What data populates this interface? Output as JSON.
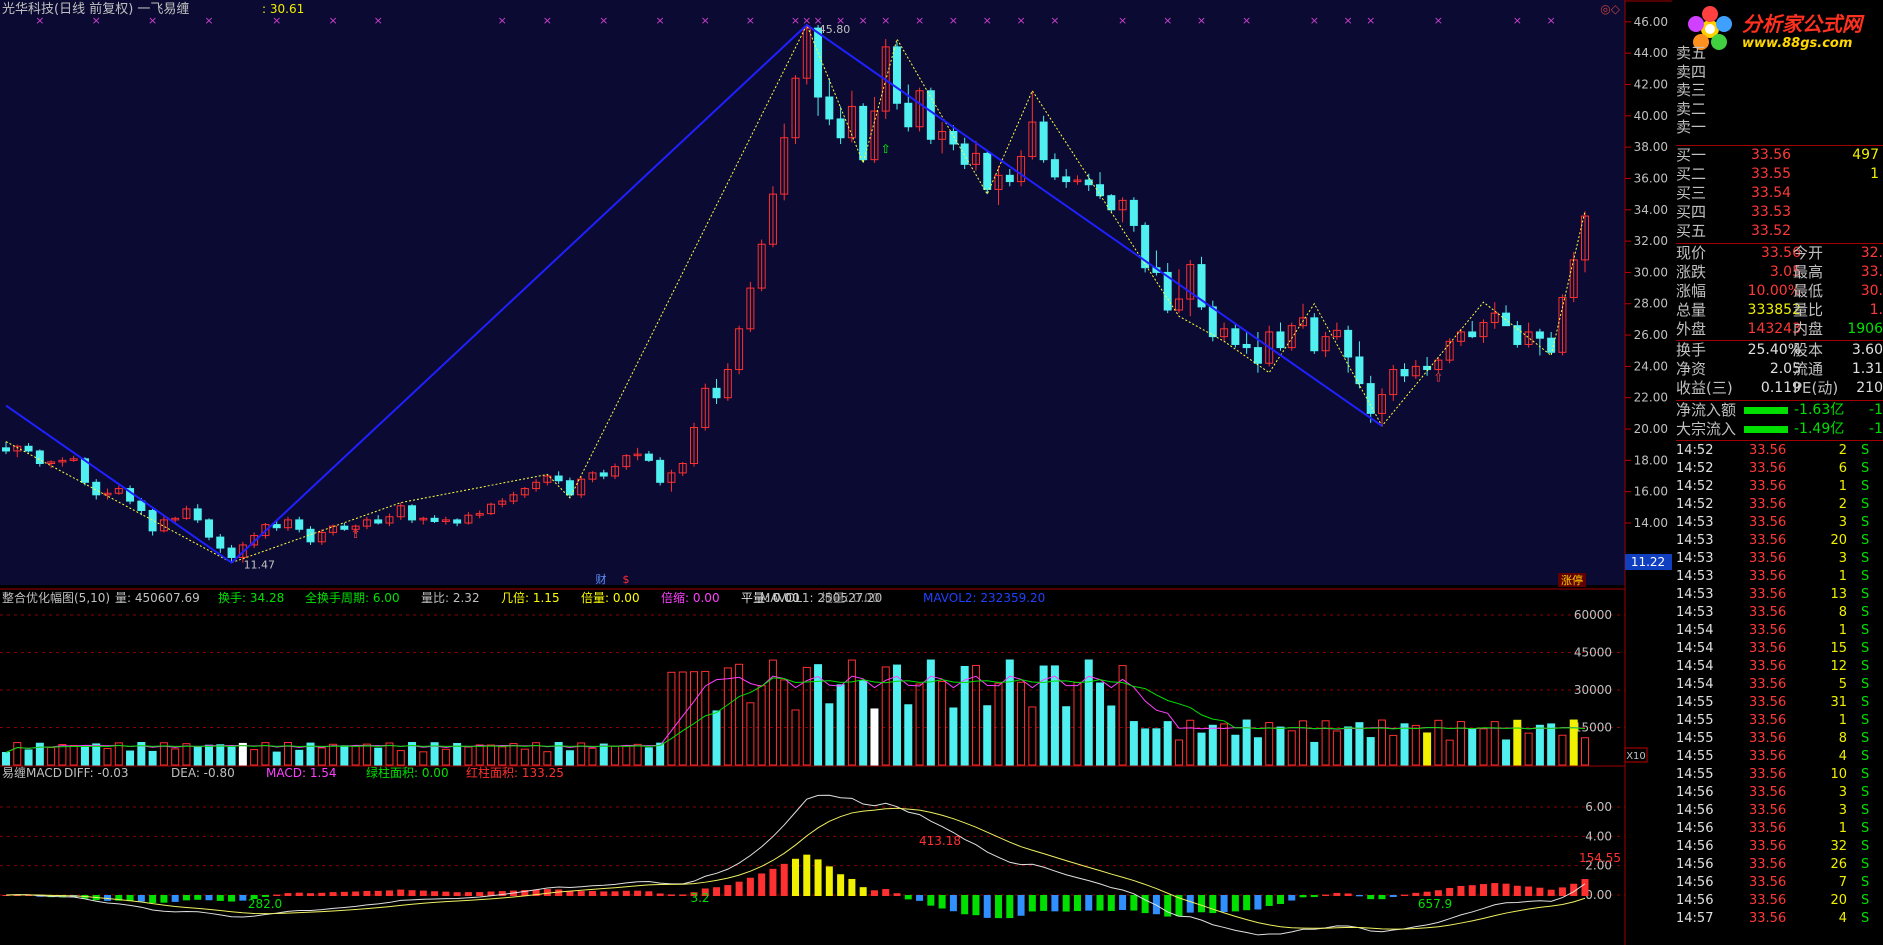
{
  "colors": {
    "up": "#ff3030",
    "down": "#50f0f0",
    "blue_line": "#2020ff",
    "zig": "#ffff40",
    "panel_bg": "#0a0a32",
    "grid": "#8a0000",
    "text": "#c0c0c0"
  },
  "main_chart": {
    "title": "光华科技(日线 前复权) 一飞易缠",
    "value": ": 30.61",
    "y_ticks": [
      "46.00",
      "44.00",
      "42.00",
      "40.00",
      "38.00",
      "36.00",
      "34.00",
      "32.00",
      "30.00",
      "28.00",
      "26.00",
      "24.00",
      "22.00",
      "20.00",
      "18.00",
      "16.00",
      "14.00"
    ],
    "peak_label": "45.80",
    "low_label": "11.47",
    "last_price_tag": "11.22",
    "marker_cai": "财",
    "marker_dollar": "$",
    "marker_zt": "涨停",
    "marker_x": "×",
    "corner_icons": "◎◇"
  },
  "chart_data": {
    "type": "candlestick",
    "x_label": "trading day index",
    "ohlc": [
      [
        18.8,
        19.2,
        18.4,
        18.6
      ],
      [
        18.6,
        19.0,
        18.2,
        18.9
      ],
      [
        18.9,
        19.1,
        18.5,
        18.6
      ],
      [
        18.6,
        18.7,
        17.6,
        17.8
      ],
      [
        17.8,
        18.0,
        17.5,
        17.9
      ],
      [
        17.9,
        18.2,
        17.6,
        18.0
      ],
      [
        18.0,
        18.3,
        17.9,
        18.1
      ],
      [
        18.1,
        18.2,
        16.4,
        16.6
      ],
      [
        16.6,
        16.8,
        15.5,
        15.8
      ],
      [
        15.8,
        16.2,
        15.5,
        15.9
      ],
      [
        15.9,
        16.4,
        15.8,
        16.2
      ],
      [
        16.2,
        16.4,
        15.2,
        15.4
      ],
      [
        15.4,
        15.6,
        14.5,
        14.8
      ],
      [
        14.8,
        14.9,
        13.2,
        13.5
      ],
      [
        13.5,
        14.5,
        13.4,
        14.2
      ],
      [
        14.2,
        14.4,
        14.0,
        14.3
      ],
      [
        14.3,
        15.1,
        14.2,
        14.9
      ],
      [
        14.9,
        15.2,
        14.0,
        14.2
      ],
      [
        14.2,
        14.3,
        12.9,
        13.1
      ],
      [
        13.1,
        13.3,
        12.1,
        12.4
      ],
      [
        12.4,
        12.6,
        11.5,
        11.8
      ],
      [
        11.8,
        12.8,
        11.47,
        12.6
      ],
      [
        12.6,
        13.4,
        12.4,
        13.2
      ],
      [
        13.2,
        14.0,
        13.0,
        13.9
      ],
      [
        13.9,
        14.2,
        13.5,
        13.7
      ],
      [
        13.7,
        14.4,
        13.5,
        14.2
      ],
      [
        14.2,
        14.4,
        13.4,
        13.6
      ],
      [
        13.6,
        13.8,
        12.6,
        12.8
      ],
      [
        12.8,
        13.6,
        12.6,
        13.4
      ],
      [
        13.4,
        13.9,
        13.2,
        13.8
      ],
      [
        13.8,
        14.0,
        13.5,
        13.6
      ],
      [
        13.6,
        13.9,
        13.3,
        13.8
      ],
      [
        13.8,
        14.4,
        13.6,
        14.2
      ],
      [
        14.2,
        14.5,
        13.9,
        14.0
      ],
      [
        14.0,
        14.6,
        13.8,
        14.4
      ],
      [
        14.4,
        15.3,
        14.2,
        15.1
      ],
      [
        15.1,
        15.2,
        14.0,
        14.2
      ],
      [
        14.2,
        14.4,
        13.9,
        14.3
      ],
      [
        14.3,
        14.5,
        14.0,
        14.1
      ],
      [
        14.1,
        14.4,
        13.9,
        14.2
      ],
      [
        14.2,
        14.3,
        13.8,
        14.0
      ],
      [
        14.0,
        14.7,
        13.9,
        14.5
      ],
      [
        14.5,
        14.8,
        14.3,
        14.6
      ],
      [
        14.6,
        15.3,
        14.5,
        15.2
      ],
      [
        15.2,
        15.6,
        15.0,
        15.4
      ],
      [
        15.4,
        16.0,
        15.2,
        15.8
      ],
      [
        15.8,
        16.3,
        15.6,
        16.2
      ],
      [
        16.2,
        16.8,
        16.0,
        16.6
      ],
      [
        16.6,
        17.1,
        16.4,
        17.0
      ],
      [
        17.0,
        17.3,
        16.5,
        16.7
      ],
      [
        16.7,
        16.9,
        15.6,
        15.8
      ],
      [
        15.8,
        17.0,
        15.6,
        16.8
      ],
      [
        16.8,
        17.3,
        16.6,
        17.2
      ],
      [
        17.2,
        17.4,
        16.8,
        17.0
      ],
      [
        17.0,
        17.8,
        16.8,
        17.6
      ],
      [
        17.6,
        18.4,
        17.4,
        18.3
      ],
      [
        18.3,
        18.8,
        18.0,
        18.4
      ],
      [
        18.4,
        18.6,
        17.9,
        18.0
      ],
      [
        18.0,
        18.2,
        16.4,
        16.6
      ],
      [
        16.6,
        17.4,
        16.0,
        17.2
      ],
      [
        17.2,
        17.9,
        17.0,
        17.8
      ],
      [
        17.8,
        20.4,
        17.6,
        20.1
      ],
      [
        20.1,
        22.9,
        19.9,
        22.6
      ],
      [
        22.6,
        23.2,
        21.6,
        22.0
      ],
      [
        22.0,
        24.2,
        21.8,
        23.8
      ],
      [
        23.8,
        26.6,
        23.5,
        26.4
      ],
      [
        26.4,
        29.4,
        26.2,
        29.0
      ],
      [
        29.0,
        32.1,
        28.8,
        31.8
      ],
      [
        31.8,
        35.5,
        31.6,
        35.0
      ],
      [
        35.0,
        39.5,
        34.6,
        38.6
      ],
      [
        38.6,
        42.6,
        38.2,
        42.4
      ],
      [
        42.4,
        45.8,
        42.0,
        45.6
      ],
      [
        45.6,
        45.8,
        40.0,
        41.2
      ],
      [
        41.2,
        42.4,
        39.4,
        39.8
      ],
      [
        39.8,
        40.6,
        38.2,
        38.6
      ],
      [
        38.6,
        41.6,
        38.3,
        40.6
      ],
      [
        40.6,
        40.8,
        37.0,
        37.2
      ],
      [
        37.2,
        41.2,
        37.0,
        40.3
      ],
      [
        40.3,
        44.9,
        39.8,
        44.4
      ],
      [
        44.4,
        44.7,
        40.4,
        40.8
      ],
      [
        40.8,
        42.0,
        39.0,
        39.3
      ],
      [
        39.3,
        41.8,
        39.0,
        41.6
      ],
      [
        41.6,
        41.8,
        38.2,
        38.5
      ],
      [
        38.5,
        39.6,
        37.6,
        39.0
      ],
      [
        39.0,
        39.4,
        37.8,
        38.2
      ],
      [
        38.2,
        38.6,
        36.6,
        36.9
      ],
      [
        36.9,
        38.4,
        36.5,
        37.6
      ],
      [
        37.6,
        37.8,
        35.0,
        35.3
      ],
      [
        35.3,
        36.8,
        34.3,
        36.2
      ],
      [
        36.2,
        36.6,
        35.5,
        35.8
      ],
      [
        35.8,
        37.8,
        35.5,
        37.4
      ],
      [
        37.4,
        41.6,
        37.2,
        39.6
      ],
      [
        39.6,
        40.0,
        37.0,
        37.2
      ],
      [
        37.2,
        37.6,
        35.9,
        36.1
      ],
      [
        36.1,
        36.6,
        35.4,
        35.8
      ],
      [
        35.8,
        36.2,
        35.6,
        35.9
      ],
      [
        35.9,
        36.3,
        35.2,
        35.6
      ],
      [
        35.6,
        36.4,
        34.7,
        34.9
      ],
      [
        34.9,
        35.0,
        33.8,
        34.0
      ],
      [
        34.0,
        34.8,
        33.2,
        34.6
      ],
      [
        34.6,
        34.8,
        32.6,
        33.0
      ],
      [
        33.0,
        33.2,
        30.0,
        30.3
      ],
      [
        30.3,
        31.4,
        29.8,
        30.0
      ],
      [
        30.0,
        30.6,
        27.4,
        27.6
      ],
      [
        27.6,
        30.2,
        27.4,
        28.3
      ],
      [
        28.3,
        30.8,
        27.2,
        30.5
      ],
      [
        30.5,
        31.0,
        27.6,
        27.8
      ],
      [
        27.8,
        28.2,
        25.6,
        25.9
      ],
      [
        25.9,
        26.8,
        25.6,
        26.4
      ],
      [
        26.4,
        26.7,
        25.2,
        25.4
      ],
      [
        25.4,
        26.2,
        24.8,
        25.2
      ],
      [
        25.2,
        26.2,
        23.6,
        24.2
      ],
      [
        24.2,
        26.6,
        24.0,
        26.2
      ],
      [
        26.2,
        26.8,
        25.0,
        25.2
      ],
      [
        25.2,
        26.8,
        25.0,
        26.6
      ],
      [
        26.6,
        28.0,
        26.4,
        27.1
      ],
      [
        27.1,
        27.4,
        24.8,
        25.0
      ],
      [
        25.0,
        26.2,
        24.6,
        25.9
      ],
      [
        25.9,
        26.8,
        25.7,
        26.3
      ],
      [
        26.3,
        26.6,
        23.6,
        24.6
      ],
      [
        24.6,
        25.6,
        22.6,
        22.9
      ],
      [
        22.9,
        23.4,
        20.4,
        21.0
      ],
      [
        21.0,
        22.6,
        20.2,
        22.2
      ],
      [
        22.2,
        24.1,
        21.8,
        23.8
      ],
      [
        23.8,
        24.2,
        23.0,
        23.4
      ],
      [
        23.4,
        24.4,
        23.2,
        24.0
      ],
      [
        24.0,
        24.6,
        23.4,
        23.8
      ],
      [
        23.8,
        24.6,
        23.6,
        24.4
      ],
      [
        24.4,
        25.8,
        24.2,
        25.6
      ],
      [
        25.6,
        26.4,
        25.3,
        26.2
      ],
      [
        26.2,
        26.9,
        25.8,
        25.9
      ],
      [
        25.9,
        27.0,
        25.5,
        26.8
      ],
      [
        26.8,
        28.1,
        26.4,
        27.4
      ],
      [
        27.4,
        27.9,
        26.8,
        26.6
      ],
      [
        26.6,
        26.9,
        25.2,
        25.4
      ],
      [
        25.4,
        26.8,
        25.2,
        26.2
      ],
      [
        26.2,
        26.4,
        24.7,
        25.8
      ],
      [
        25.8,
        26.2,
        24.8,
        24.9
      ],
      [
        24.9,
        28.6,
        24.7,
        28.4
      ],
      [
        28.4,
        31.3,
        28.1,
        30.8
      ],
      [
        30.8,
        33.9,
        30.0,
        33.6
      ]
    ]
  },
  "vol_panel": {
    "title": "整合优化幅图(5,10)",
    "items": [
      {
        "k": "量:",
        "v": "450607.69"
      },
      {
        "k": "换手:",
        "v": "34.28"
      },
      {
        "k": "全换手周期:",
        "v": "6.00"
      },
      {
        "k": "量比:",
        "v": "2.32"
      },
      {
        "k": "几倍:",
        "v": "1.15"
      },
      {
        "k": "倍量:",
        "v": "0.00"
      },
      {
        "k": "倍缩:",
        "v": "0.00"
      },
      {
        "k": "平量:",
        "v": "0.00"
      },
      {
        "k": "地量:",
        "v": "0.00"
      },
      {
        "k": "MAVOL1:",
        "v": "250527.20"
      },
      {
        "k": "MAVOL2:",
        "v": "232359.20"
      }
    ],
    "y_ticks": [
      "60000",
      "45000",
      "30000",
      "15000"
    ],
    "x_tag": "X10"
  },
  "macd_panel": {
    "title": "易缠MACD",
    "items": [
      {
        "k": "DIFF:",
        "v": "-0.03"
      },
      {
        "k": "DEA:",
        "v": "-0.80"
      },
      {
        "k": "MACD:",
        "v": "1.54"
      },
      {
        "k": "绿柱面积:",
        "v": "0.00"
      },
      {
        "k": "红柱面积:",
        "v": "133.25"
      }
    ],
    "y_ticks": [
      "6.00",
      "4.00",
      "2.00",
      "0.00"
    ],
    "area_labels": [
      "282.0",
      "3.2",
      "413.18",
      "657.9",
      "154.55"
    ]
  },
  "right_panel": {
    "logo_text": "分析家公式网",
    "logo_url": "www.88gs.com",
    "sell_labels": [
      "卖五",
      "卖四",
      "卖三",
      "卖二",
      "卖一"
    ],
    "buy": [
      {
        "label": "买一",
        "price": "33.56",
        "vol": "497"
      },
      {
        "label": "买二",
        "price": "33.55",
        "vol": "1"
      },
      {
        "label": "买三",
        "price": "33.54",
        "vol": ""
      },
      {
        "label": "买四",
        "price": "33.53",
        "vol": ""
      },
      {
        "label": "买五",
        "price": "33.52",
        "vol": ""
      }
    ],
    "quote": [
      {
        "k1": "现价",
        "v1": "33.56",
        "k2": "今开",
        "v2": "32."
      },
      {
        "k1": "涨跌",
        "v1": "3.05",
        "k2": "最高",
        "v2": "33."
      },
      {
        "k1": "涨幅",
        "v1": "10.00%",
        "k2": "最低",
        "v2": "30."
      },
      {
        "k1": "总量",
        "v1": "333852",
        "k2": "量比",
        "v2": "1."
      },
      {
        "k1": "外盘",
        "v1": "143243",
        "k2": "内盘",
        "v2": "1906"
      }
    ],
    "stats": [
      {
        "k1": "换手",
        "v1": "25.40%",
        "k2": "股本",
        "v2": "3.60"
      },
      {
        "k1": "净资",
        "v1": "2.05",
        "k2": "流通",
        "v2": "1.31"
      },
      {
        "k1": "收益(三)",
        "v1": "0.119",
        "k2": "PE(动)",
        "v2": "210"
      }
    ],
    "flows": [
      {
        "k": "净流入额",
        "v": "-1.63亿",
        "v2": "-1"
      },
      {
        "k": "大宗流入",
        "v": "-1.49亿",
        "v2": "-1"
      }
    ],
    "ticks": [
      {
        "t": "14:52",
        "p": "33.56",
        "v": "2",
        "s": "S"
      },
      {
        "t": "14:52",
        "p": "33.56",
        "v": "6",
        "s": "S"
      },
      {
        "t": "14:52",
        "p": "33.56",
        "v": "1",
        "s": "S"
      },
      {
        "t": "14:52",
        "p": "33.56",
        "v": "2",
        "s": "S"
      },
      {
        "t": "14:53",
        "p": "33.56",
        "v": "3",
        "s": "S"
      },
      {
        "t": "14:53",
        "p": "33.56",
        "v": "20",
        "s": "S"
      },
      {
        "t": "14:53",
        "p": "33.56",
        "v": "3",
        "s": "S"
      },
      {
        "t": "14:53",
        "p": "33.56",
        "v": "1",
        "s": "S"
      },
      {
        "t": "14:53",
        "p": "33.56",
        "v": "13",
        "s": "S"
      },
      {
        "t": "14:53",
        "p": "33.56",
        "v": "8",
        "s": "S"
      },
      {
        "t": "14:54",
        "p": "33.56",
        "v": "1",
        "s": "S"
      },
      {
        "t": "14:54",
        "p": "33.56",
        "v": "15",
        "s": "S"
      },
      {
        "t": "14:54",
        "p": "33.56",
        "v": "12",
        "s": "S"
      },
      {
        "t": "14:54",
        "p": "33.56",
        "v": "5",
        "s": "S"
      },
      {
        "t": "14:55",
        "p": "33.56",
        "v": "31",
        "s": "S"
      },
      {
        "t": "14:55",
        "p": "33.56",
        "v": "1",
        "s": "S"
      },
      {
        "t": "14:55",
        "p": "33.56",
        "v": "8",
        "s": "S"
      },
      {
        "t": "14:55",
        "p": "33.56",
        "v": "4",
        "s": "S"
      },
      {
        "t": "14:55",
        "p": "33.56",
        "v": "10",
        "s": "S"
      },
      {
        "t": "14:56",
        "p": "33.56",
        "v": "3",
        "s": "S"
      },
      {
        "t": "14:56",
        "p": "33.56",
        "v": "3",
        "s": "S"
      },
      {
        "t": "14:56",
        "p": "33.56",
        "v": "1",
        "s": "S"
      },
      {
        "t": "14:56",
        "p": "33.56",
        "v": "32",
        "s": "S"
      },
      {
        "t": "14:56",
        "p": "33.56",
        "v": "26",
        "s": "S"
      },
      {
        "t": "14:56",
        "p": "33.56",
        "v": "7",
        "s": "S"
      },
      {
        "t": "14:56",
        "p": "33.56",
        "v": "20",
        "s": "S"
      },
      {
        "t": "14:57",
        "p": "33.56",
        "v": "4",
        "s": "S"
      }
    ]
  }
}
